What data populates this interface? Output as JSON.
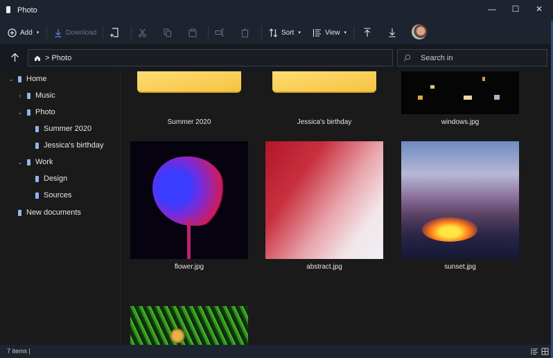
{
  "window": {
    "title": "Photo",
    "controls": {
      "minimize": "—",
      "maximize": "☐",
      "close": "✕"
    }
  },
  "toolbar": {
    "add_label": "Add",
    "download_label": "Download",
    "sort_label": "Sort",
    "view_label": "View",
    "caret": "▾",
    "icons": [
      "add-circle-icon",
      "download-icon",
      "new-page-icon",
      "cut-icon",
      "copy-icon",
      "paste-icon",
      "rename-icon",
      "delete-icon",
      "sort-icon",
      "view-icon",
      "move-to-top-icon",
      "move-down-icon",
      "avatar"
    ]
  },
  "address": {
    "breadcrumb": [
      "Photo"
    ],
    "separator": ">",
    "search_placeholder": "Search in"
  },
  "sidebar": {
    "items": [
      {
        "label": "Home",
        "level": 0,
        "chevron": "⌄",
        "expanded": true
      },
      {
        "label": "Music",
        "level": 1,
        "chevron": "›",
        "expanded": false
      },
      {
        "label": "Photo",
        "level": 1,
        "chevron": "⌄",
        "expanded": true
      },
      {
        "label": "Summer 2020",
        "level": 2,
        "chevron": ""
      },
      {
        "label": "Jessica's birthday",
        "level": 2,
        "chevron": ""
      },
      {
        "label": "Work",
        "level": 1,
        "chevron": "⌄",
        "expanded": true
      },
      {
        "label": "Design",
        "level": 2,
        "chevron": ""
      },
      {
        "label": "Sources",
        "level": 2,
        "chevron": ""
      },
      {
        "label": "New documents",
        "level": 0,
        "chevron": ""
      }
    ]
  },
  "content": {
    "items": [
      {
        "name": "Summer 2020",
        "type": "folder"
      },
      {
        "name": "Jessica's birthday",
        "type": "folder"
      },
      {
        "name": "windows.jpg",
        "type": "image"
      },
      {
        "name": "flower.jpg",
        "type": "image"
      },
      {
        "name": "abstract.jpg",
        "type": "image"
      },
      {
        "name": "sunset.jpg",
        "type": "image"
      },
      {
        "name": "",
        "type": "image"
      }
    ]
  },
  "status": {
    "item_count": "7 items |"
  },
  "colors": {
    "accent": "#8fb7ee",
    "folder": "#f6c341",
    "titlebar": "#1d2430",
    "content_bg": "#1a1a1a"
  }
}
